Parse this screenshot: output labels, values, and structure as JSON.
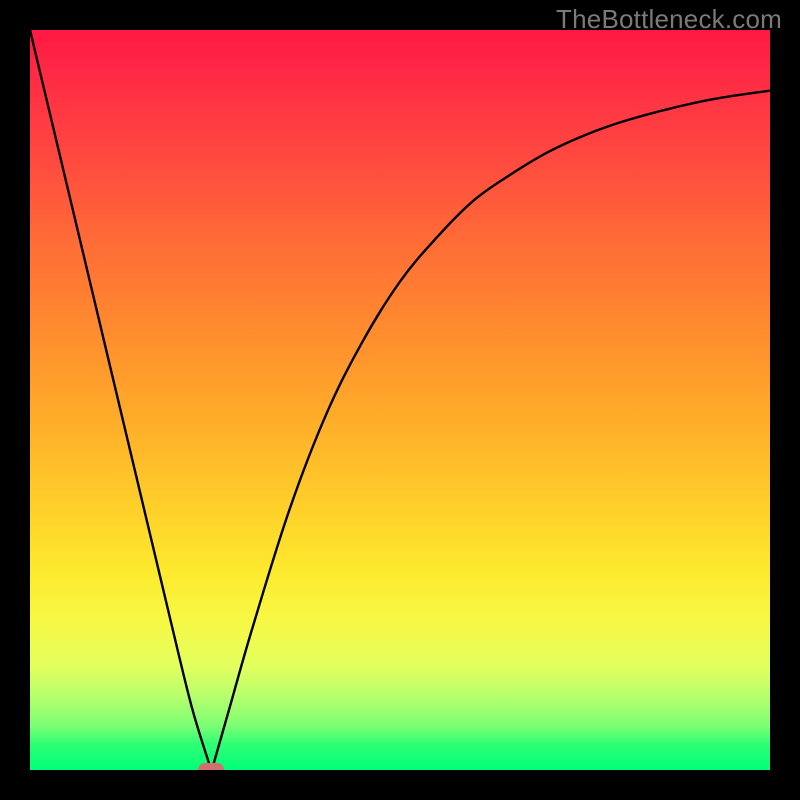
{
  "watermark": "TheBottleneck.com",
  "colors": {
    "frame_bg": "#000000",
    "curve": "#000000",
    "marker": "#d17070",
    "gradient_top": "#ff1844",
    "gradient_bottom": "#00ff78"
  },
  "chart_data": {
    "type": "line",
    "title": "",
    "xlabel": "",
    "ylabel": "",
    "xlim": [
      0,
      100
    ],
    "ylim": [
      0,
      100
    ],
    "grid": false,
    "annotations": [],
    "marker": {
      "x": 24.5,
      "y": 0,
      "shape": "rounded-rect"
    },
    "series": [
      {
        "name": "bottleneck-curve",
        "x": [
          0,
          5,
          10,
          15,
          20,
          22,
          24,
          24.5,
          25,
          27,
          30,
          35,
          40,
          45,
          50,
          55,
          60,
          65,
          70,
          75,
          80,
          85,
          90,
          95,
          100
        ],
        "y": [
          100,
          79,
          58,
          37,
          16,
          8,
          1.5,
          0,
          1.5,
          8.5,
          19,
          35,
          48,
          58,
          66,
          72,
          77,
          80.5,
          83.5,
          85.8,
          87.6,
          89,
          90.2,
          91.1,
          91.8
        ]
      }
    ]
  }
}
